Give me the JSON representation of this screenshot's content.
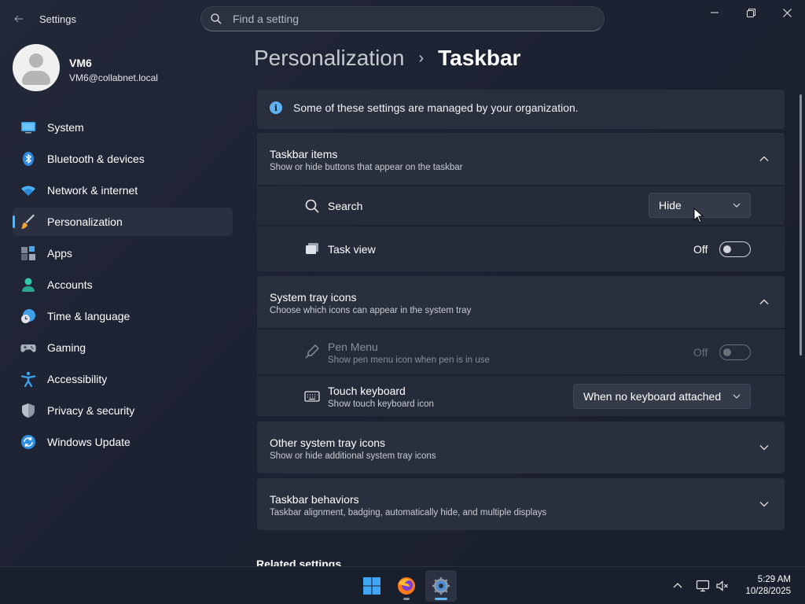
{
  "window": {
    "app_title": "Settings",
    "search_placeholder": "Find a setting"
  },
  "profile": {
    "name": "VM6",
    "email": "VM6@collabnet.local"
  },
  "sidebar": {
    "items": [
      {
        "label": "System",
        "icon": "monitor-icon",
        "active": false
      },
      {
        "label": "Bluetooth & devices",
        "icon": "bluetooth-icon",
        "active": false
      },
      {
        "label": "Network & internet",
        "icon": "wifi-icon",
        "active": false
      },
      {
        "label": "Personalization",
        "icon": "paintbrush-icon",
        "active": true
      },
      {
        "label": "Apps",
        "icon": "apps-icon",
        "active": false
      },
      {
        "label": "Accounts",
        "icon": "person-icon",
        "active": false
      },
      {
        "label": "Time & language",
        "icon": "clock-globe-icon",
        "active": false
      },
      {
        "label": "Gaming",
        "icon": "gamepad-icon",
        "active": false
      },
      {
        "label": "Accessibility",
        "icon": "accessibility-icon",
        "active": false
      },
      {
        "label": "Privacy & security",
        "icon": "shield-icon",
        "active": false
      },
      {
        "label": "Windows Update",
        "icon": "update-icon",
        "active": false
      }
    ]
  },
  "breadcrumb": {
    "parent": "Personalization",
    "separator": "›",
    "current": "Taskbar"
  },
  "info_banner": {
    "icon": "i",
    "text": "Some of these settings are managed by your organization."
  },
  "taskbar_items": {
    "title": "Taskbar items",
    "subtitle": "Show or hide buttons that appear on the taskbar",
    "search": {
      "label": "Search",
      "value": "Hide"
    },
    "task_view": {
      "label": "Task view",
      "state": "Off"
    }
  },
  "system_tray_icons": {
    "title": "System tray icons",
    "subtitle": "Choose which icons can appear in the system tray",
    "pen_menu": {
      "label": "Pen Menu",
      "subtitle": "Show pen menu icon when pen is in use",
      "state": "Off"
    },
    "touch_keyboard": {
      "label": "Touch keyboard",
      "subtitle": "Show touch keyboard icon",
      "value": "When no keyboard attached"
    }
  },
  "other_tray_icons": {
    "title": "Other system tray icons",
    "subtitle": "Show or hide additional system tray icons"
  },
  "taskbar_behaviors": {
    "title": "Taskbar behaviors",
    "subtitle": "Taskbar alignment, badging, automatically hide, and multiple displays"
  },
  "related_settings": {
    "title": "Related settings"
  },
  "os_taskbar": {
    "time": "5:29 AM",
    "date": "10/28/2025"
  },
  "colors": {
    "accent": "#5fb2f2",
    "background": "#1d2232",
    "card": "#2a2f3d"
  }
}
